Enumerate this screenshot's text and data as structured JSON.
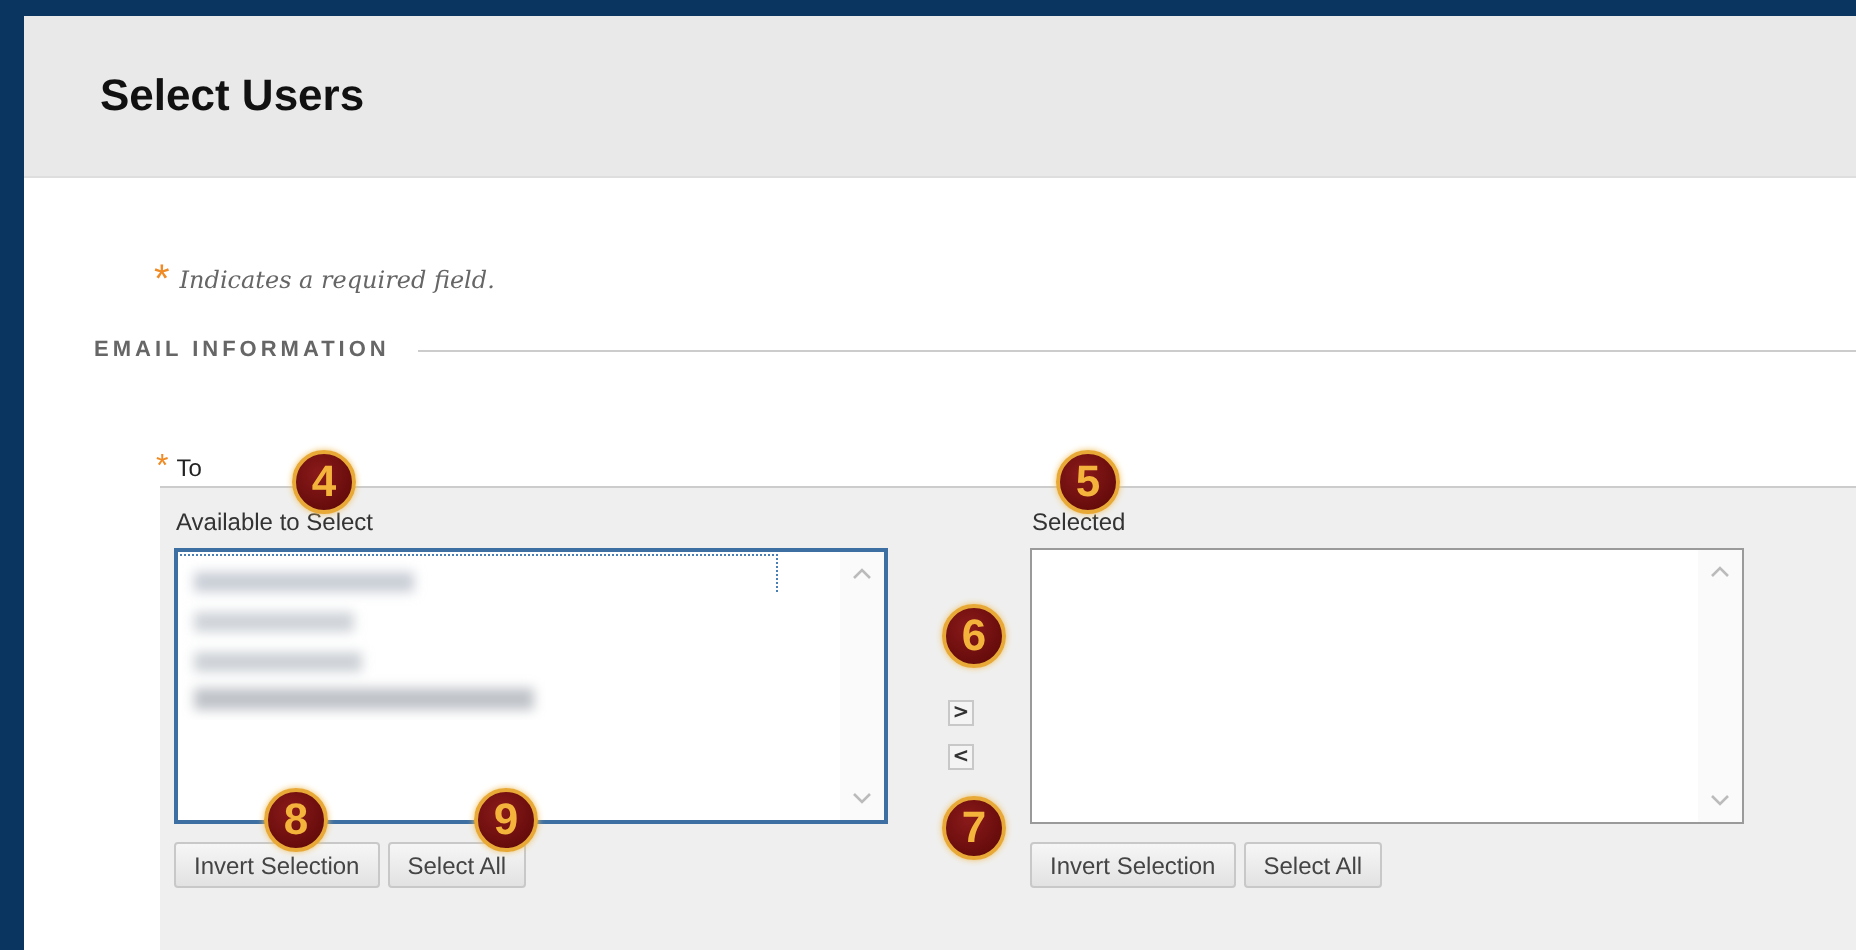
{
  "page": {
    "title": "Select Users"
  },
  "required_note": {
    "mark": "*",
    "text": "Indicates a required field."
  },
  "section": {
    "title": "EMAIL INFORMATION"
  },
  "field": {
    "required_mark": "*",
    "label": "To"
  },
  "lists": [
    {
      "label": "Available to Select",
      "focused": true,
      "buttons": [
        "Invert Selection",
        "Select All"
      ]
    },
    {
      "label": "Selected",
      "focused": false,
      "buttons": [
        "Invert Selection",
        "Select All"
      ]
    }
  ],
  "move_buttons": [
    {
      "symbol": ">"
    },
    {
      "symbol": "<"
    }
  ],
  "callouts": [
    {
      "label": "4"
    },
    {
      "label": "5"
    },
    {
      "label": "6"
    },
    {
      "label": "8"
    },
    {
      "label": "9"
    },
    {
      "label": "7"
    }
  ]
}
